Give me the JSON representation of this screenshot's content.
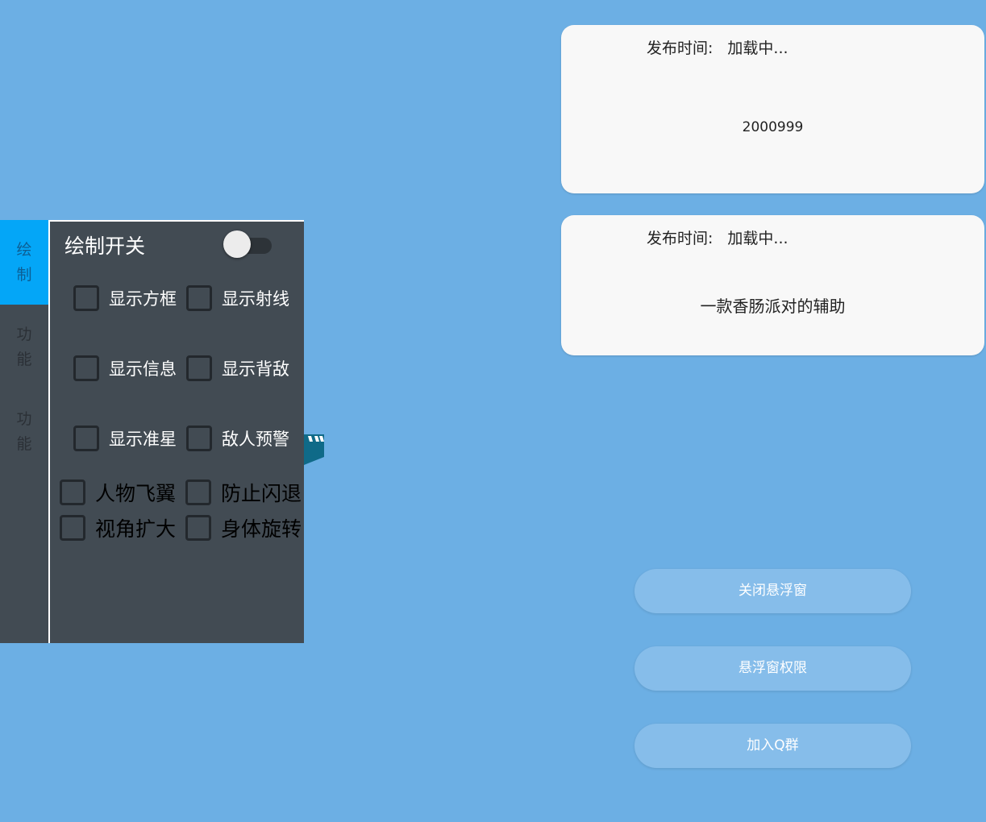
{
  "cards": [
    {
      "label": "发布时间:",
      "value": "加载中...",
      "body": "2000999"
    },
    {
      "label": "发布时间:",
      "value": "加载中...",
      "body": "一款香肠派对的辅助"
    }
  ],
  "buttons": {
    "close_float": "关闭悬浮窗",
    "float_permission": "悬浮窗权限",
    "join_group": "加入Q群"
  },
  "menu": {
    "tabs": [
      {
        "label": "绘制",
        "active": true
      },
      {
        "label": "功能",
        "active": false
      },
      {
        "label": "功能",
        "active": false
      }
    ],
    "title": "绘制开关",
    "toggle_on": false,
    "options": [
      {
        "label": "显示方框",
        "checked": false
      },
      {
        "label": "显示射线",
        "checked": false
      },
      {
        "label": "显示信息",
        "checked": false
      },
      {
        "label": "显示背敌",
        "checked": false
      },
      {
        "label": "显示准星",
        "checked": false
      },
      {
        "label": "敌人预警",
        "checked": false
      },
      {
        "label": "人物飞翼",
        "checked": false
      },
      {
        "label": "防止闪退",
        "checked": false
      },
      {
        "label": "视角扩大",
        "checked": false
      },
      {
        "label": "身体旋转",
        "checked": false
      }
    ]
  },
  "colors": {
    "background": "#6cafe4",
    "panel": "#424b53",
    "tab_active": "#04a6f7",
    "button": "#86bdea"
  }
}
